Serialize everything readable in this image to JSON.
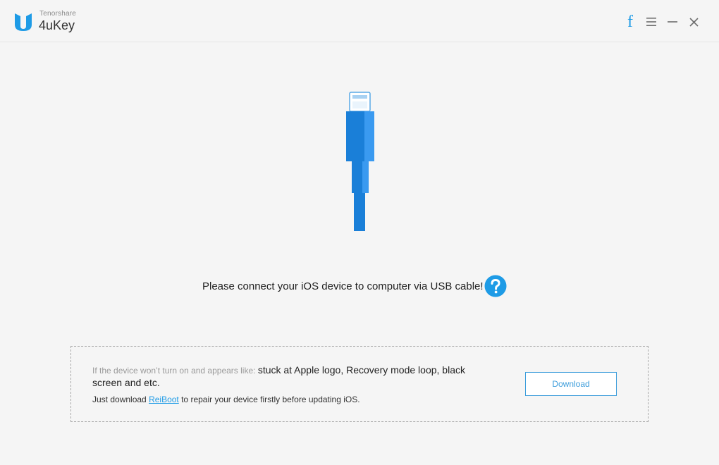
{
  "header": {
    "company": "Tenorshare",
    "product": "4uKey",
    "facebook_glyph": "f"
  },
  "icons": {
    "logo": "tenorshare-logo",
    "facebook": "facebook-icon",
    "menu": "menu-icon",
    "minimize": "minimize-icon",
    "close": "close-icon",
    "cable": "lightning-cable-icon",
    "help": "help-icon"
  },
  "main": {
    "connect_message": "Please connect your iOS device to computer via USB cable!"
  },
  "info_box": {
    "prefix": "If the device won’t turn on and appears like: ",
    "symptoms": "stuck at Apple logo, Recovery mode loop, black screen and etc.",
    "line2_before": "Just download ",
    "link_text": "ReiBoot",
    "line2_after": " to repair your device firstly before updating iOS.",
    "download_label": "Download"
  },
  "colors": {
    "accent": "#1e9be6",
    "cable_blue": "#1a7fd8",
    "cable_light": "#3a9af0",
    "background": "#f5f5f5"
  }
}
